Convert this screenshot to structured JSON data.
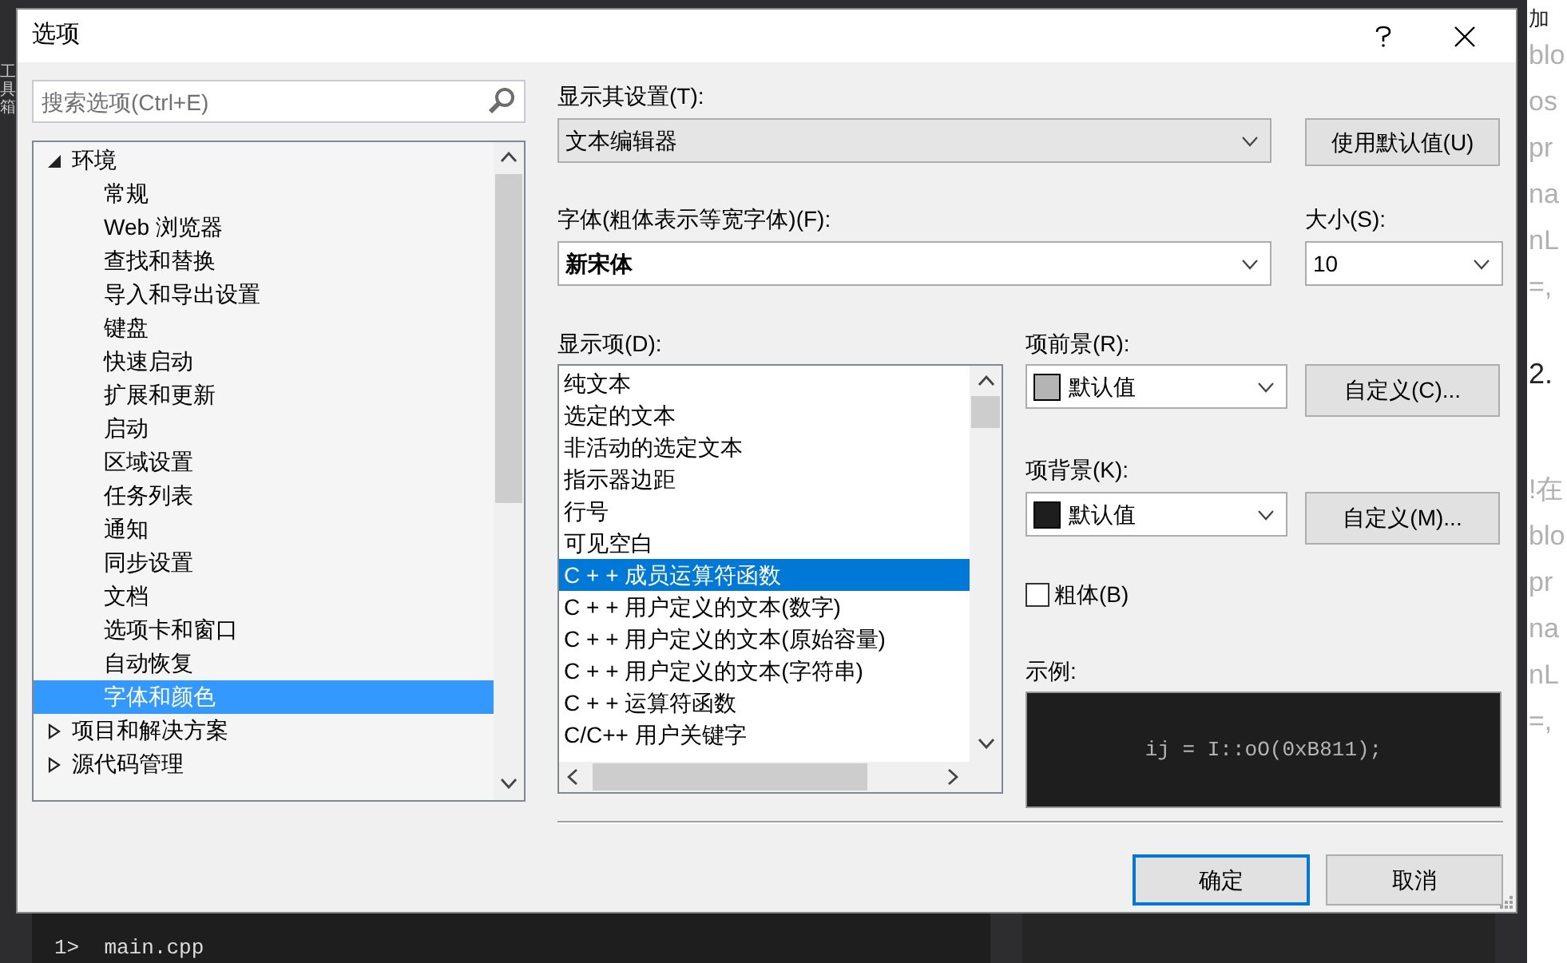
{
  "background": {
    "side_tab": "工具箱",
    "output_lines": [
      "1>  main.cpp"
    ],
    "web_fragments": [
      "加",
      "blo",
      "os",
      "pr",
      "na",
      "nL",
      "=,",
      "2.",
      "!在",
      "blo",
      "pr",
      "na",
      "nL",
      "=,"
    ]
  },
  "window": {
    "title": "选项"
  },
  "search": {
    "placeholder": "搜索选项(Ctrl+E)"
  },
  "tree": [
    {
      "label": "环境",
      "expanded": true,
      "selected": false,
      "children": [
        {
          "label": "常规",
          "selected": false
        },
        {
          "label": "Web 浏览器",
          "selected": false
        },
        {
          "label": "查找和替换",
          "selected": false
        },
        {
          "label": "导入和导出设置",
          "selected": false
        },
        {
          "label": "键盘",
          "selected": false
        },
        {
          "label": "快速启动",
          "selected": false
        },
        {
          "label": "扩展和更新",
          "selected": false
        },
        {
          "label": "启动",
          "selected": false
        },
        {
          "label": "区域设置",
          "selected": false
        },
        {
          "label": "任务列表",
          "selected": false
        },
        {
          "label": "通知",
          "selected": false
        },
        {
          "label": "同步设置",
          "selected": false
        },
        {
          "label": "文档",
          "selected": false
        },
        {
          "label": "选项卡和窗口",
          "selected": false
        },
        {
          "label": "自动恢复",
          "selected": false
        },
        {
          "label": "字体和颜色",
          "selected": true
        }
      ]
    },
    {
      "label": "项目和解决方案",
      "expanded": false,
      "selected": false
    },
    {
      "label": "源代码管理",
      "expanded": false,
      "selected": false
    }
  ],
  "show_settings_for": {
    "label": "显示其设置(T):",
    "value": "文本编辑器"
  },
  "use_defaults_button": "使用默认值(U)",
  "font": {
    "label": "字体(粗体表示等宽字体)(F):",
    "value": "新宋体"
  },
  "size": {
    "label": "大小(S):",
    "value": "10"
  },
  "display_items": {
    "label": "显示项(D):",
    "items": [
      {
        "label": "纯文本",
        "selected": false
      },
      {
        "label": "选定的文本",
        "selected": false
      },
      {
        "label": "非活动的选定文本",
        "selected": false
      },
      {
        "label": "指示器边距",
        "selected": false
      },
      {
        "label": "行号",
        "selected": false
      },
      {
        "label": "可见空白",
        "selected": false
      },
      {
        "label": "C + + 成员运算符函数",
        "selected": true
      },
      {
        "label": "C + + 用户定义的文本(数字)",
        "selected": false
      },
      {
        "label": "C + + 用户定义的文本(原始容量)",
        "selected": false
      },
      {
        "label": "C + + 用户定义的文本(字符串)",
        "selected": false
      },
      {
        "label": "C + + 运算符函数",
        "selected": false
      },
      {
        "label": "C/C++ 用户关键字",
        "selected": false
      }
    ]
  },
  "foreground": {
    "label": "项前景(R):",
    "value": "默认值",
    "color": "#b4b4b4",
    "button": "自定义(C)..."
  },
  "background_color": {
    "label": "项背景(K):",
    "value": "默认值",
    "color": "#1e1e1e",
    "button": "自定义(M)..."
  },
  "bold": {
    "label": "粗体(B)",
    "checked": false
  },
  "sample": {
    "label": "示例:",
    "text": "ij = I::oO(0xB811);"
  },
  "buttons": [
    "确定",
    "取消"
  ]
}
